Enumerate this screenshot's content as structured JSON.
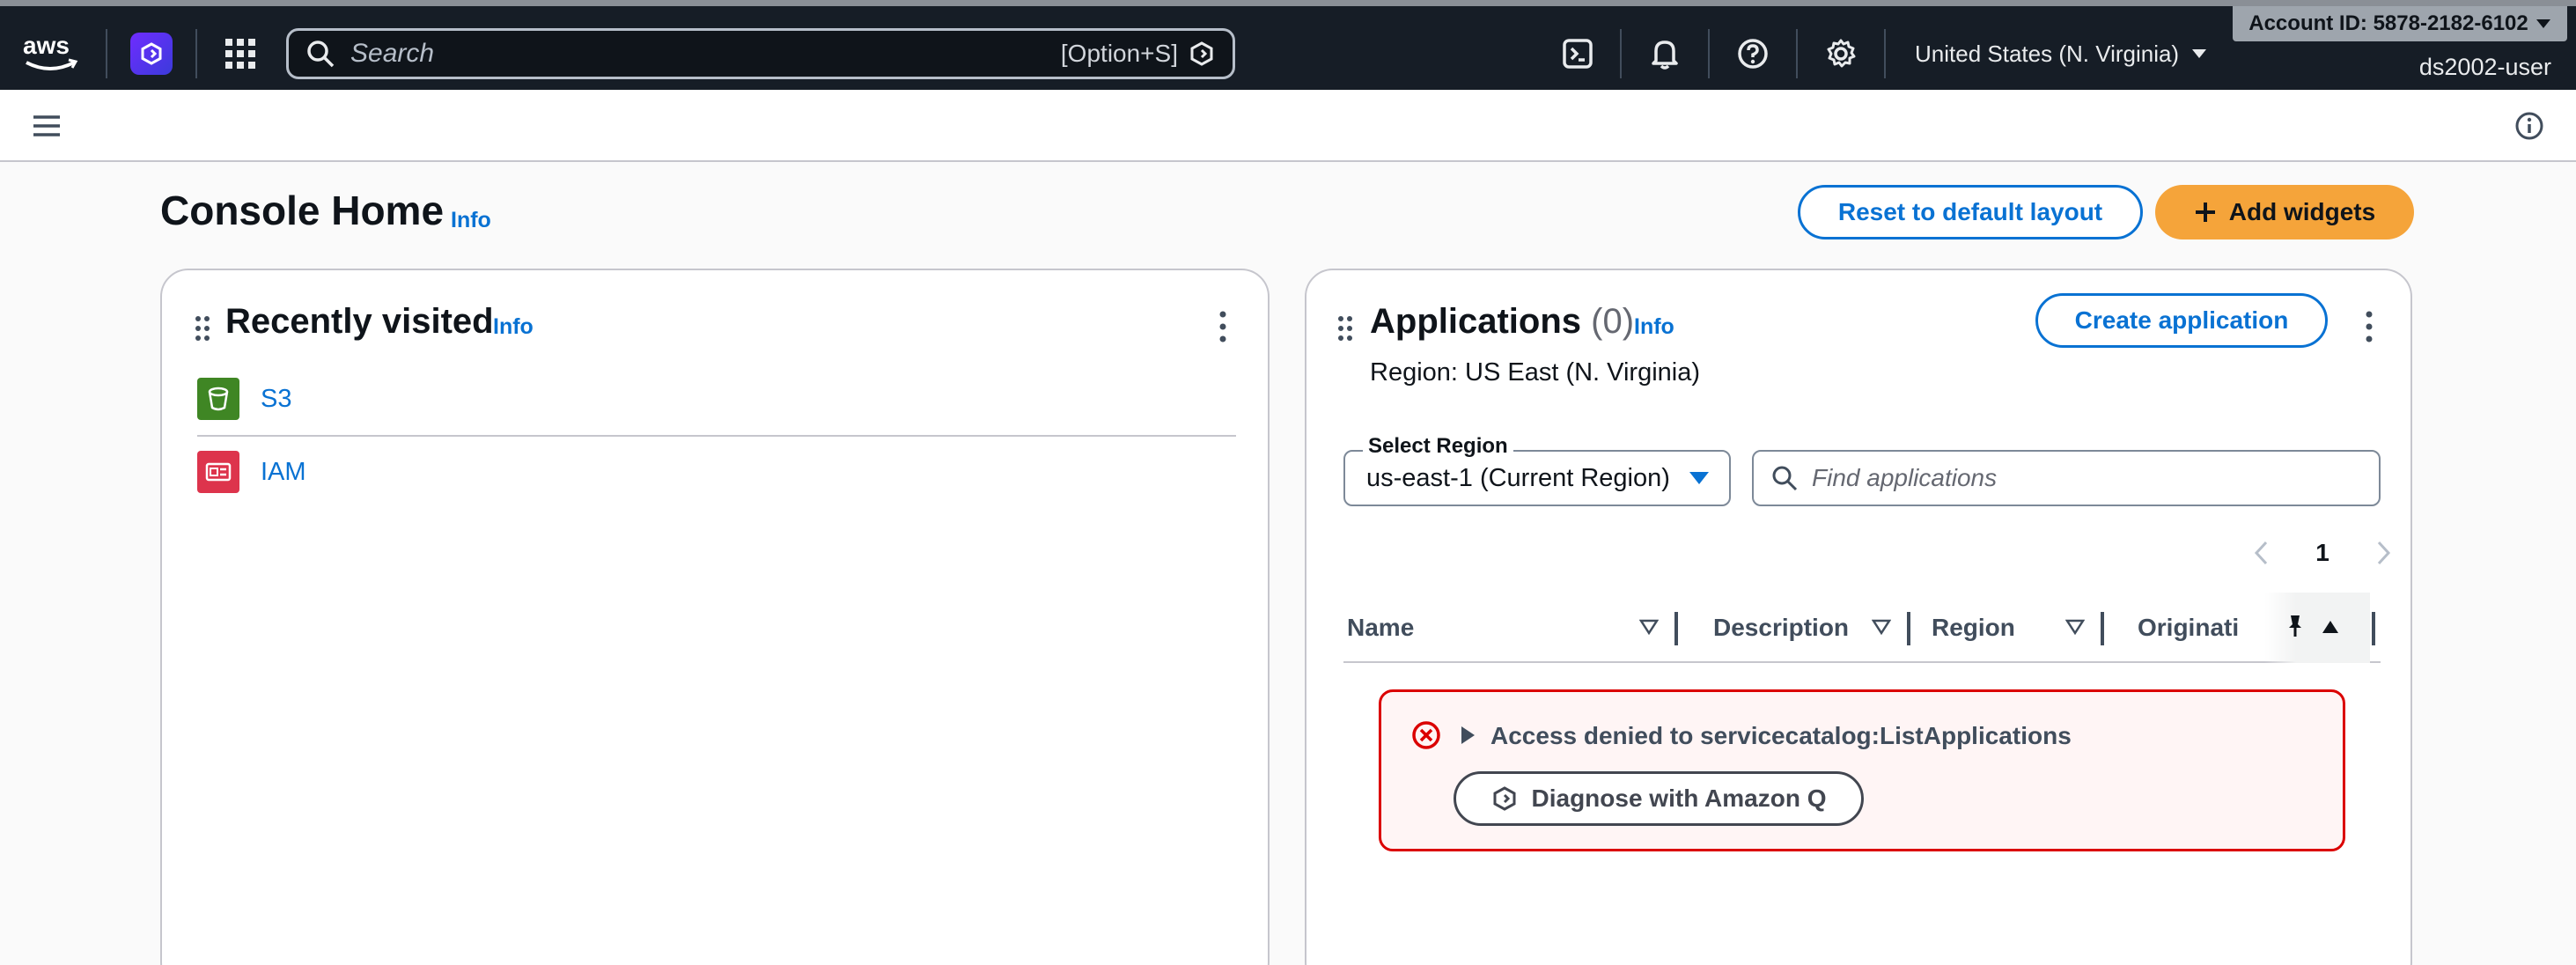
{
  "topnav": {
    "logo_text": "aws",
    "search_placeholder": "Search",
    "search_shortcut": "[Option+S]",
    "region": "United States (N. Virginia)",
    "account": "Account ID: 5878-2182-6102",
    "user": "ds2002-user"
  },
  "header": {
    "title": "Console Home",
    "info": "Info",
    "reset_label": "Reset to default layout",
    "add_widgets_label": "Add widgets"
  },
  "recently_visited": {
    "title": "Recently visited",
    "info": "Info",
    "items": [
      {
        "label": "S3",
        "color": "#3f8624"
      },
      {
        "label": "IAM",
        "color": "#dd344c"
      }
    ]
  },
  "applications": {
    "title": "Applications",
    "count": "(0)",
    "info": "Info",
    "create_label": "Create application",
    "region_text": "Region: US East (N. Virginia)",
    "select_label": "Select Region",
    "select_value": "us-east-1 (Current Region)",
    "find_placeholder": "Find applications",
    "page": "1",
    "columns": [
      "Name",
      "Description",
      "Region",
      "Originati"
    ],
    "error_title": "Access denied to servicecatalog:ListApplications",
    "diagnose_label": "Diagnose with Amazon Q"
  },
  "colors": {
    "nav_bg": "#161d26",
    "link": "#0972d3",
    "primary": "#f5a43a",
    "error": "#db0000"
  }
}
